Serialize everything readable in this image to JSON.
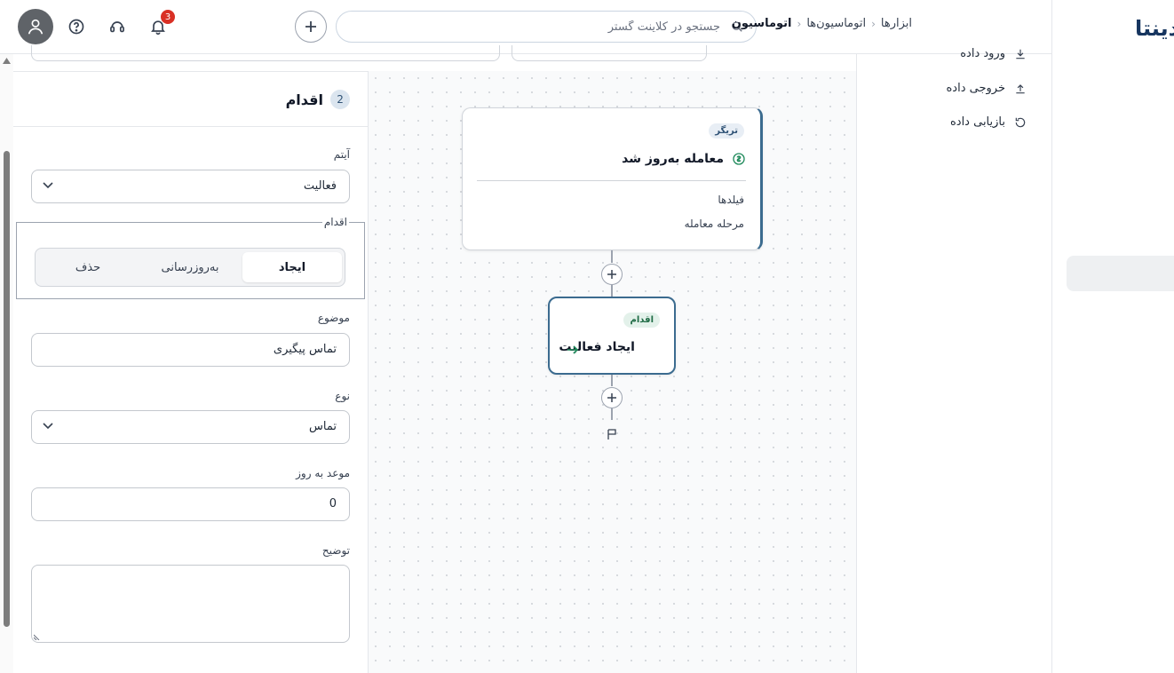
{
  "header": {
    "breadcrumb": [
      "ابزارها",
      "اتوماسیون‌ها",
      "اتوماسیون"
    ],
    "breadcrumb_separator": "‹",
    "search_placeholder": "جستجو در کلاینت گستر",
    "notification_count": "3"
  },
  "sidebar": {
    "logo_text": "دینتا"
  },
  "menu": {
    "items": [
      {
        "label": "ورود داده",
        "icon": "download-icon"
      },
      {
        "label": "خروجی داده",
        "icon": "upload-icon"
      },
      {
        "label": "بازیابی داده",
        "icon": "restore-icon"
      }
    ]
  },
  "workflow": {
    "trigger": {
      "tag": "تریگر",
      "title": "معامله به‌روز شد",
      "fields": [
        "فیلدها",
        "مرحله معامله"
      ]
    },
    "action": {
      "tag": "اقدام",
      "title": "ایجاد فعالیت"
    }
  },
  "form": {
    "step_number": "2",
    "step_title": "اقدام",
    "item_label": "آیتم",
    "item_value": "فعالیت",
    "action_legend": "اقدام",
    "action_options": [
      "ایجاد",
      "به‌روزرسانی",
      "حذف"
    ],
    "action_selected": "ایجاد",
    "subject_label": "موضوع",
    "subject_value": "تماس پیگیری",
    "type_label": "نوع",
    "type_value": "تماس",
    "due_label": "موعد به روز",
    "due_value": "0",
    "description_label": "توضیح",
    "description_value": ""
  },
  "colors": {
    "primary": "#3b6b8f",
    "badge": "#d93025",
    "logo": "#16355f"
  }
}
